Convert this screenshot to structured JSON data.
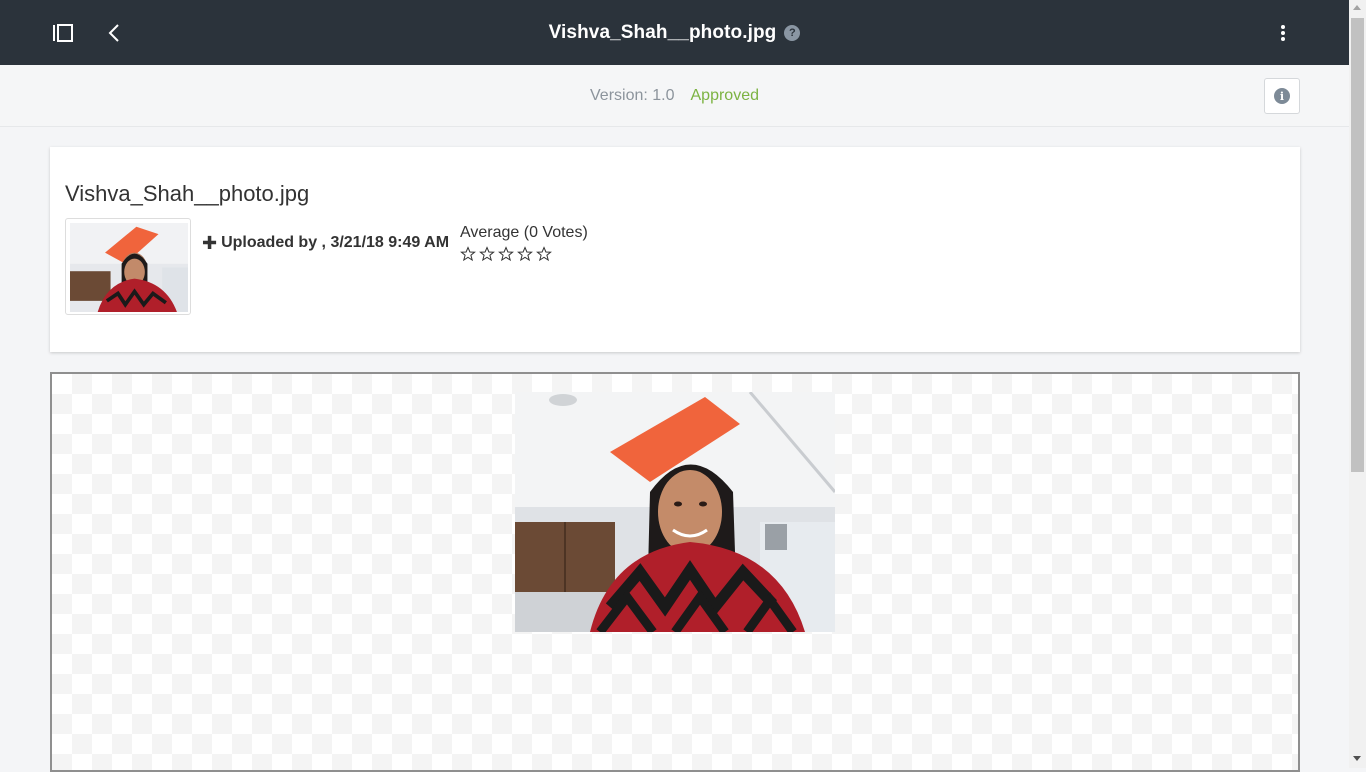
{
  "header": {
    "title": "Vishva_Shah__photo.jpg",
    "help_glyph": "?",
    "icons": [
      "sidebar-toggle-icon",
      "chevron-left-icon",
      "help-icon",
      "kebab-menu-icon"
    ]
  },
  "version_bar": {
    "version": "Version: 1.0",
    "status": "Approved",
    "status_color": "#7cb342",
    "info_glyph": "i"
  },
  "details": {
    "file_name": "Vishva_Shah__photo.jpg",
    "uploaded_label": "Uploaded by , 3/21/18 9:49 AM",
    "rating_label": "Average (0 Votes)",
    "stars_filled": 0,
    "stars_total": 5
  },
  "colors": {
    "header_bg": "#2b333b",
    "accent_approved": "#7cb342",
    "page_bg": "#f4f5f7"
  }
}
